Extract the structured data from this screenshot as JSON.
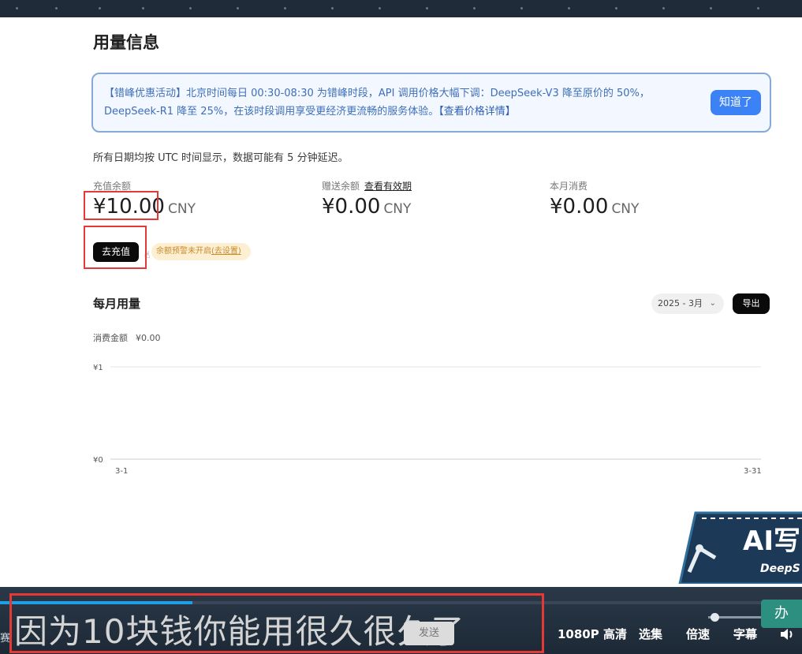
{
  "page": {
    "title": "用量信息",
    "notice": {
      "text": "【错峰优惠活动】北京时间每日 00:30-08:30 为错峰时段，API 调用价格大幅下调：DeepSeek-V3 降至原价的 50%，DeepSeek-R1 降至 25%，在该时段调用享受更经济更流畅的服务体验。",
      "link": "【查看价格详情】",
      "button": "知道了"
    },
    "hint": "所有日期均按 UTC 时间显示，数据可能有 5 分钟延迟。",
    "stats": [
      {
        "label": "充值余额",
        "link": "",
        "amount": "¥10.00",
        "currency": "CNY"
      },
      {
        "label": "赠送余额",
        "link": "查看有效期",
        "amount": "¥0.00",
        "currency": "CNY"
      },
      {
        "label": "本月消费",
        "link": "",
        "amount": "¥0.00",
        "currency": "CNY"
      }
    ],
    "recharge_button": "去充值",
    "warning": {
      "text": "余额预警未开启",
      "link": "(去设置)"
    },
    "monthly": {
      "title": "每月用量",
      "month": "2025 - 3月",
      "export": "导出",
      "spent_label": "消费金额",
      "spent_value": "¥0.00"
    }
  },
  "chart_data": {
    "type": "line",
    "x": [
      "3-1",
      "3-31"
    ],
    "yticks": [
      "¥0",
      "¥1"
    ],
    "ylim": [
      0,
      1
    ],
    "series": [
      {
        "values": [
          0,
          0
        ]
      }
    ]
  },
  "player": {
    "subtitle": "因为10块钱你能用很久很久了",
    "send": "发送",
    "quality": "1080P 高清",
    "episodes": "选集",
    "speed": "倍速",
    "caption": "字幕",
    "left_glyph": "赛",
    "progress": 0.24,
    "volume": 0.12,
    "overlay_badge": "AI写",
    "overlay_sub": "DeepS",
    "green_button": "办"
  }
}
